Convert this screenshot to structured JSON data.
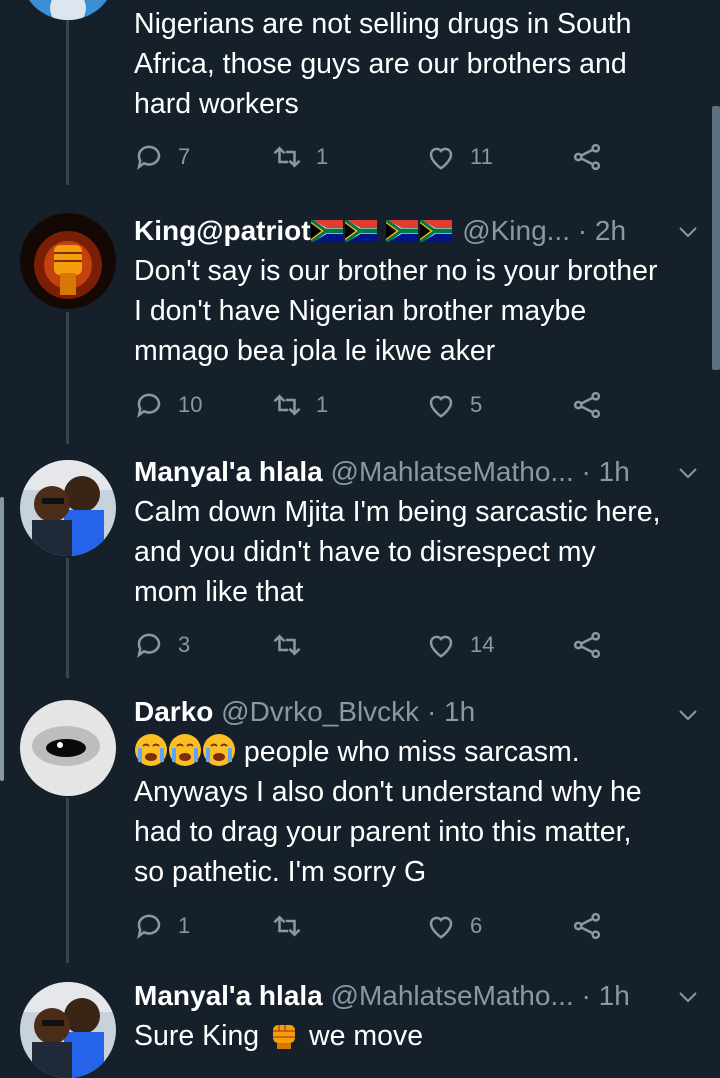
{
  "colors": {
    "background": "#15202b",
    "text": "#ffffff",
    "secondary": "#8899a6",
    "line": "#38444d"
  },
  "tweets": [
    {
      "body": [
        "Nigerians are not selling drugs in South",
        "Africa, those guys are our brothers and",
        "hard workers"
      ],
      "replies": "7",
      "retweets": "1",
      "likes": "11"
    },
    {
      "name": "King@patriot",
      "handle": "@King...",
      "time": " · 2h",
      "body": [
        "Don't say is our brother no is your brother",
        "I don't have Nigerian brother maybe",
        "mmago bea jola le ikwe aker"
      ],
      "replies": "10",
      "retweets": "1",
      "likes": "5"
    },
    {
      "name": "Manyal'a hlala",
      "handle": "@MahlatseMatho...",
      "time": " · 1h",
      "body": [
        "Calm down Mjita I'm being sarcastic here,",
        "and you didn't have to disrespect my",
        "mom like that"
      ],
      "replies": "3",
      "retweets": "",
      "likes": "14"
    },
    {
      "name": "Darko",
      "handle": "@Dvrko_Blvckk",
      "time": " · 1h",
      "body_first_suffix": " people who miss sarcasm.",
      "body": [
        "Anyways I also don't understand why he",
        "had to drag your parent into this matter,",
        "so pathetic. I'm sorry G"
      ],
      "replies": "1",
      "retweets": "",
      "likes": "6"
    },
    {
      "name": "Manyal'a hlala",
      "handle": "@MahlatseMatho...",
      "time": " · 1h",
      "body_prefix": "Sure King ",
      "body_suffix": " we move"
    }
  ],
  "icons": [
    "reply-icon",
    "retweet-icon",
    "like-icon",
    "share-icon",
    "chevron-down-icon",
    "flag-south-africa-icon",
    "crying-face-emoji",
    "fist-emoji"
  ]
}
